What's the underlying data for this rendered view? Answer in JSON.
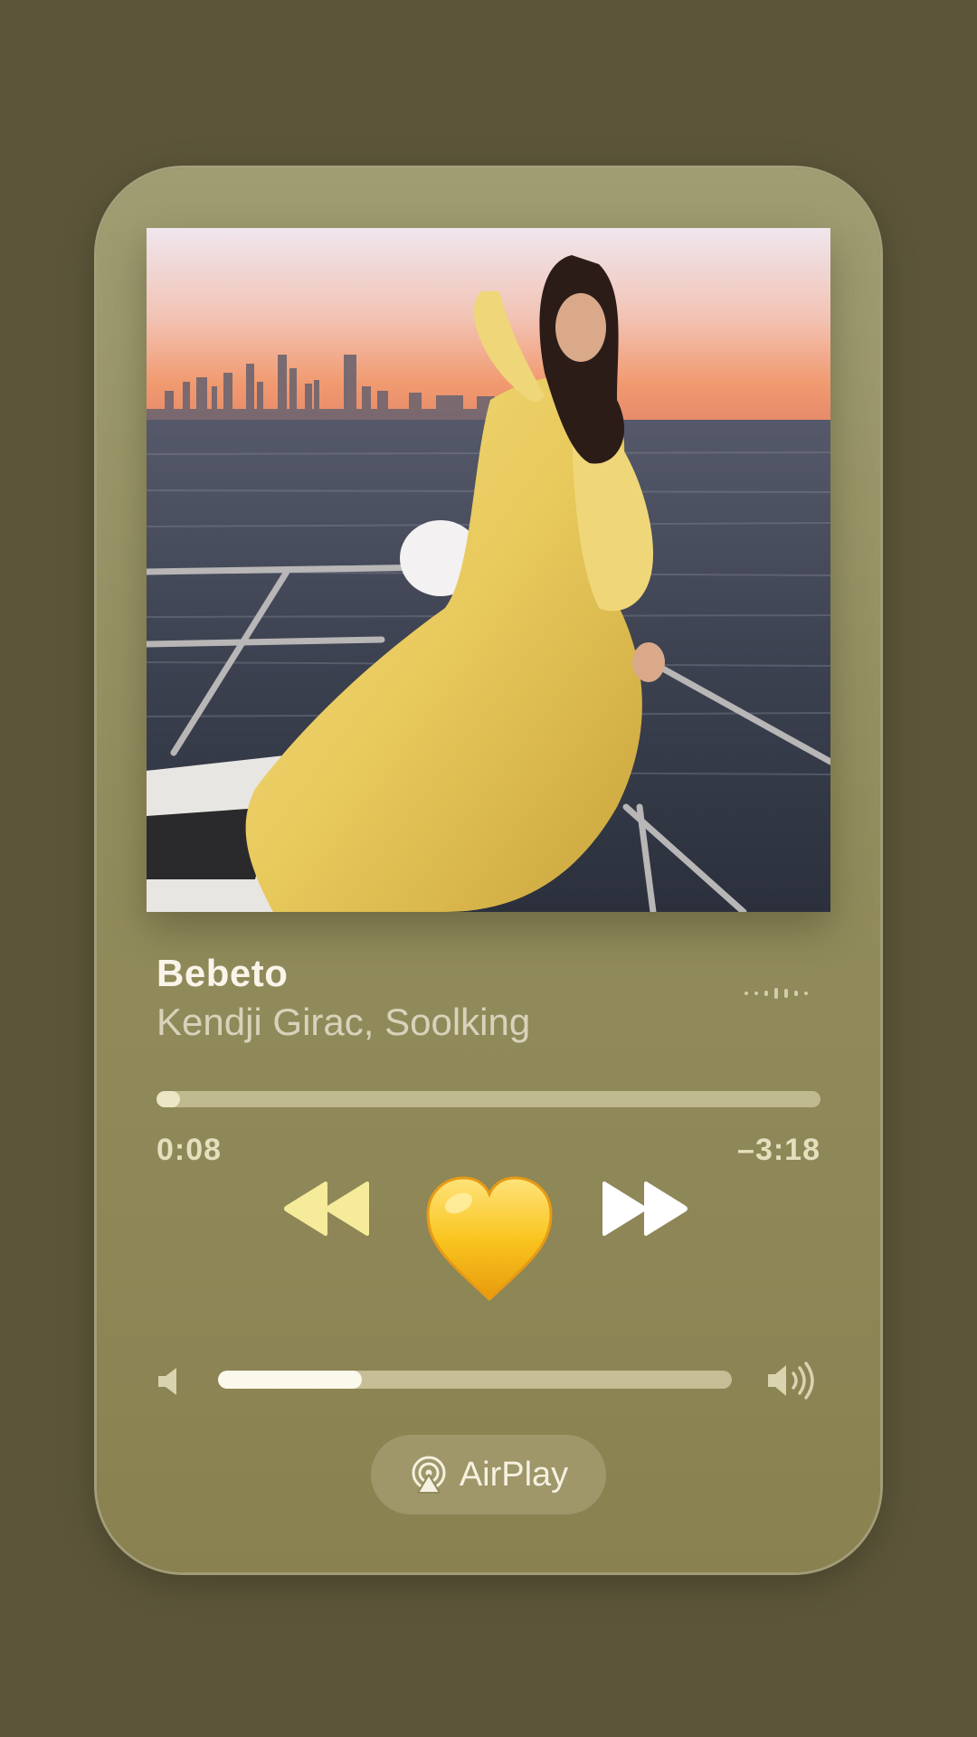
{
  "song": {
    "title": "Bebeto",
    "artist": "Kendji Girac, Soolking"
  },
  "playback": {
    "elapsed": "0:08",
    "remaining": "–3:18",
    "progress_fraction": 0.035
  },
  "volume": {
    "level_fraction": 0.28
  },
  "controls": {
    "rewind_icon": "rewind-icon",
    "center_icon": "yellow-heart-emoji",
    "forward_icon": "fast-forward-icon"
  },
  "airplay": {
    "label": "AirPlay",
    "icon": "airplay-icon"
  },
  "colors": {
    "background": "#5c5539",
    "card": "#928d5e",
    "rewind_icon": "#f5eb9a",
    "heart": "#f5c518"
  }
}
